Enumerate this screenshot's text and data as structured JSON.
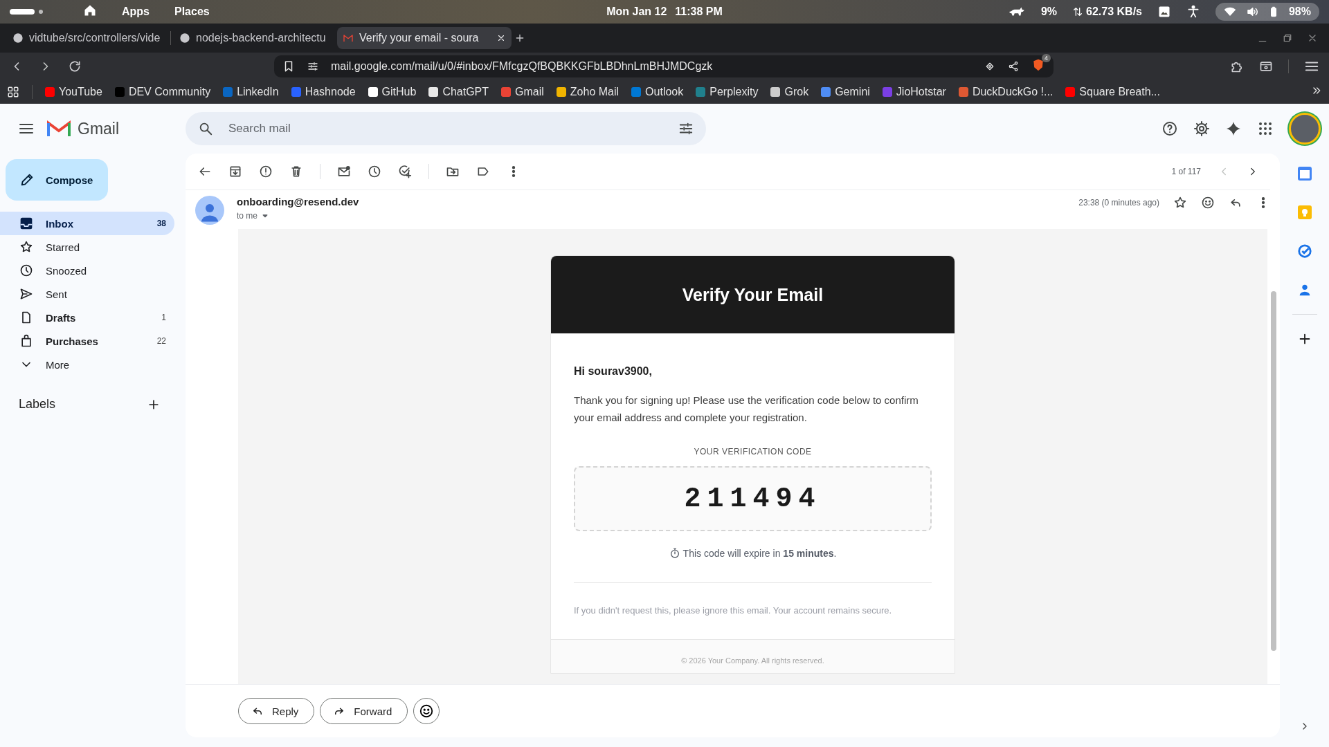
{
  "os_bar": {
    "menus": [
      "Apps",
      "Places"
    ],
    "date": "Mon Jan 12",
    "time": "11:38 PM",
    "cpu": "9%",
    "network": "62.73 KB/s",
    "battery": "98%"
  },
  "browser": {
    "tabs": [
      {
        "title": "vidtube/src/controllers/vide",
        "selected": false
      },
      {
        "title": "nodejs-backend-architectu",
        "selected": false
      },
      {
        "title": "Verify your email - soura",
        "selected": true
      }
    ],
    "url": "mail.google.com/mail/u/0/#inbox/FMfcgzQfBQBKKGFbLBDhnLmBHJMDCgzk",
    "shield_badge": "4",
    "bookmarks": [
      "YouTube",
      "DEV Community",
      "LinkedIn",
      "Hashnode",
      "GitHub",
      "ChatGPT",
      "Gmail",
      "Zoho Mail",
      "Outlook",
      "Perplexity",
      "Grok",
      "Gemini",
      "JioHotstar",
      "DuckDuckGo !...",
      "Square Breath..."
    ]
  },
  "gmail": {
    "product": "Gmail",
    "search": {
      "placeholder": "Search mail"
    },
    "compose": "Compose",
    "nav": [
      {
        "label": "Inbox",
        "count": "38",
        "selected": true,
        "unread": true
      },
      {
        "label": "Starred",
        "selected": false,
        "unread": false
      },
      {
        "label": "Snoozed",
        "selected": false,
        "unread": false
      },
      {
        "label": "Sent",
        "selected": false,
        "unread": false
      },
      {
        "label": "Drafts",
        "count": "1",
        "selected": false,
        "unread": true
      },
      {
        "label": "Purchases",
        "count": "22",
        "selected": false,
        "unread": true
      },
      {
        "label": "More",
        "selected": false,
        "unread": false
      }
    ],
    "labels_heading": "Labels",
    "message": {
      "pager": "1 of 117",
      "sender": "onboarding@resend.dev",
      "recipient": "to me",
      "time": "23:38 (0 minutes ago)",
      "starred": false,
      "body": {
        "title": "Verify Your Email",
        "greeting": "Hi sourav3900,",
        "text": "Thank you for signing up! Please use the verification code below to confirm your email address and complete your registration.",
        "code_label": "YOUR VERIFICATION CODE",
        "code": "211494",
        "expiry": "This code will expire in **15 minutes**.",
        "notice": "If you didn't request this, please ignore this email. Your account remains secure.",
        "footer": "© 2026 Your Company. All rights reserved."
      }
    },
    "actions": [
      "Reply",
      "Forward"
    ]
  }
}
